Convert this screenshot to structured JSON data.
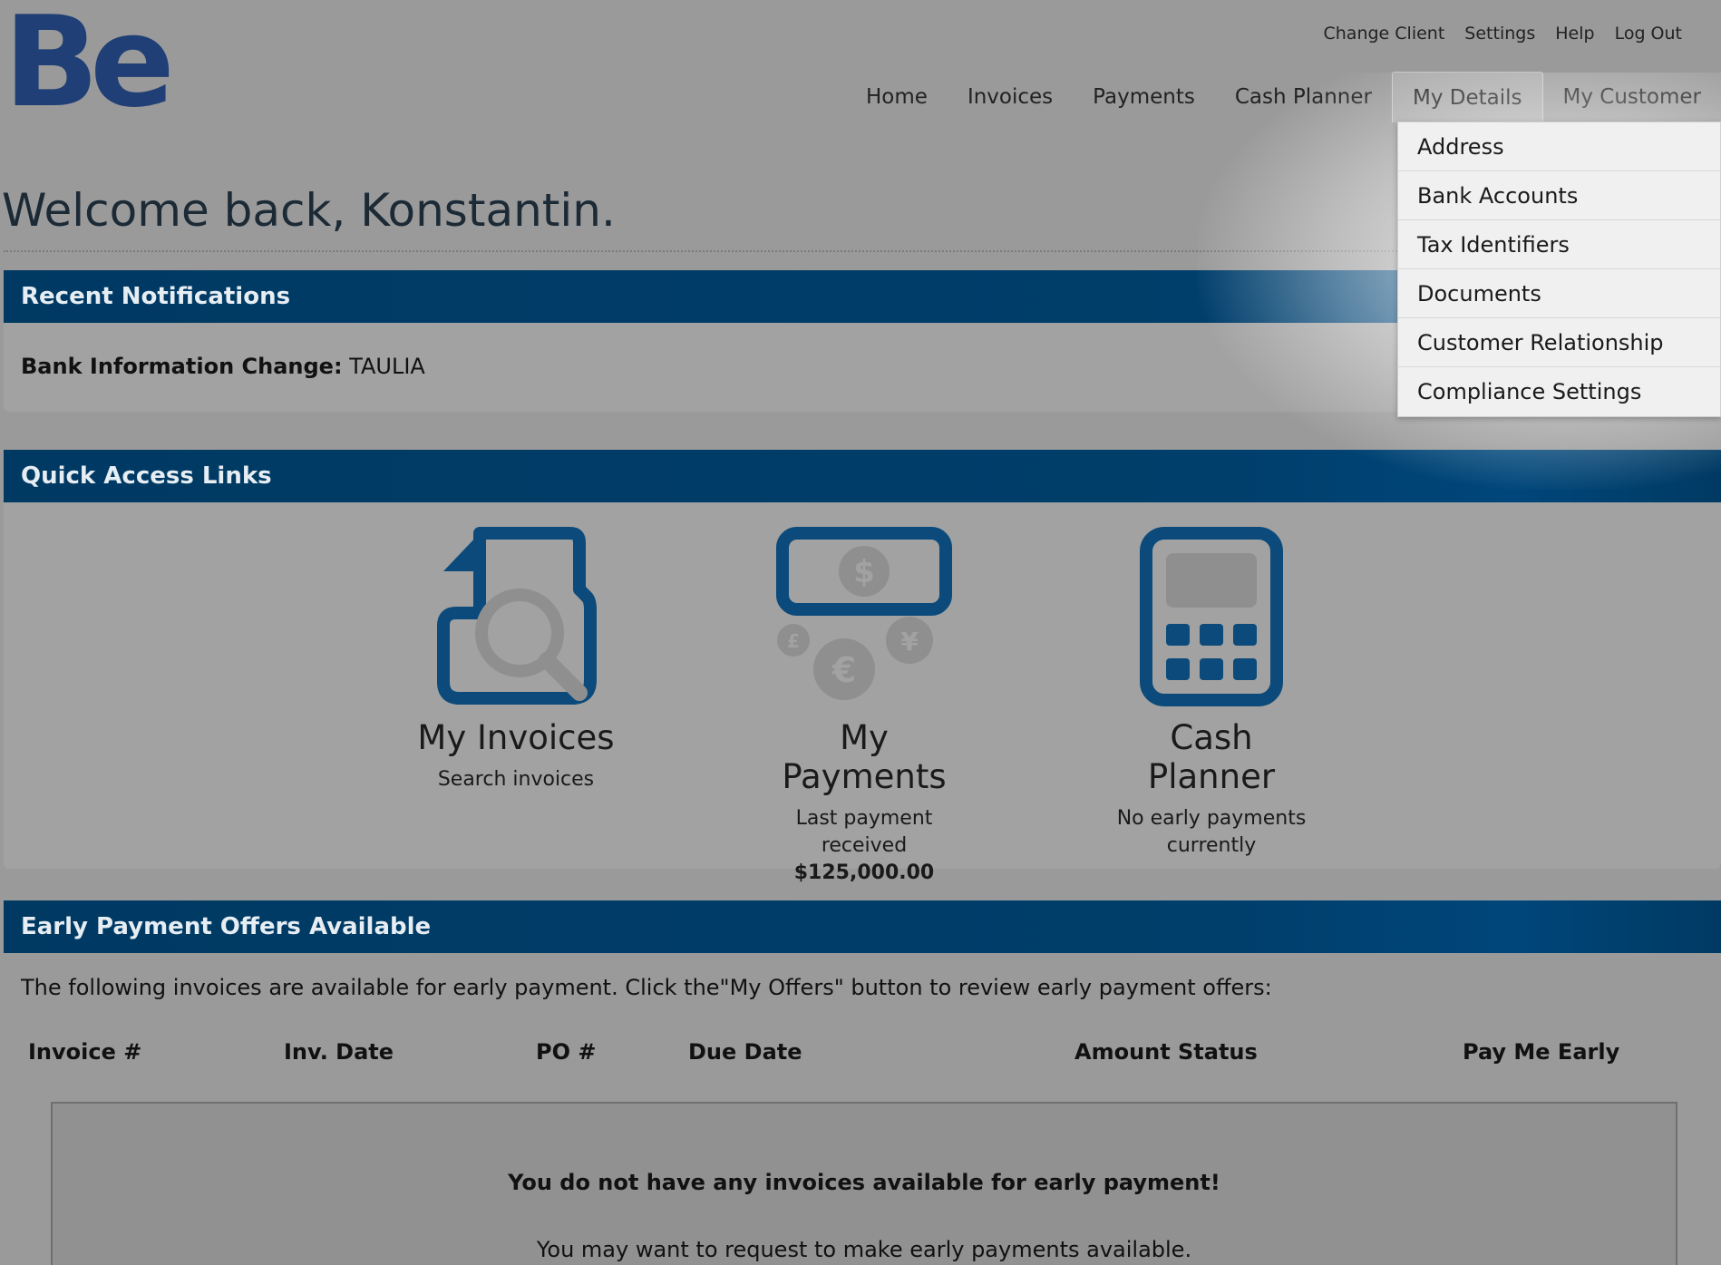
{
  "brand": {
    "logo_text": "Bell",
    "logo_color": "#1f3f76"
  },
  "utility_nav": [
    "Change Client",
    "Settings",
    "Help",
    "Log Out"
  ],
  "main_nav": [
    {
      "label": "Home",
      "active": false
    },
    {
      "label": "Invoices",
      "active": false
    },
    {
      "label": "Payments",
      "active": false
    },
    {
      "label": "Cash Planner",
      "active": false
    },
    {
      "label": "My Details",
      "active": true
    },
    {
      "label": "My Customer",
      "active": false
    }
  ],
  "my_details_menu": [
    "Address",
    "Bank Accounts",
    "Tax Identifiers",
    "Documents",
    "Customer Relationship",
    "Compliance Settings"
  ],
  "welcome": "Welcome back, Konstantin.",
  "notifications": {
    "heading": "Recent Notifications",
    "item_label": "Bank Information Change:",
    "item_value": "TAULIA"
  },
  "quick_links": {
    "heading": "Quick Access Links",
    "items": [
      {
        "icon": "invoice-search-icon",
        "title": "My Invoices",
        "sub": "Search invoices",
        "amount": ""
      },
      {
        "icon": "money-icon",
        "title": "My Payments",
        "sub": "Last payment received",
        "amount": "$125,000.00"
      },
      {
        "icon": "calculator-icon",
        "title": "Cash Planner",
        "sub": "No early payments currently",
        "amount": ""
      }
    ]
  },
  "early_payment": {
    "heading": "Early Payment Offers Available",
    "intro": "The following invoices are available for early payment. Click the\"My Offers\" button to review early payment offers:",
    "columns": [
      "Invoice #",
      "Inv. Date",
      "PO #",
      "Due Date",
      "Amount",
      "Status",
      "Pay Me Early"
    ],
    "empty_title": "You do not have any invoices available for early payment!",
    "empty_sub": "You may want to request to make early payments available."
  },
  "colors": {
    "header_blue": "#003e6b",
    "icon_blue": "#0b4a7a",
    "icon_gray": "#8f8f8f"
  }
}
